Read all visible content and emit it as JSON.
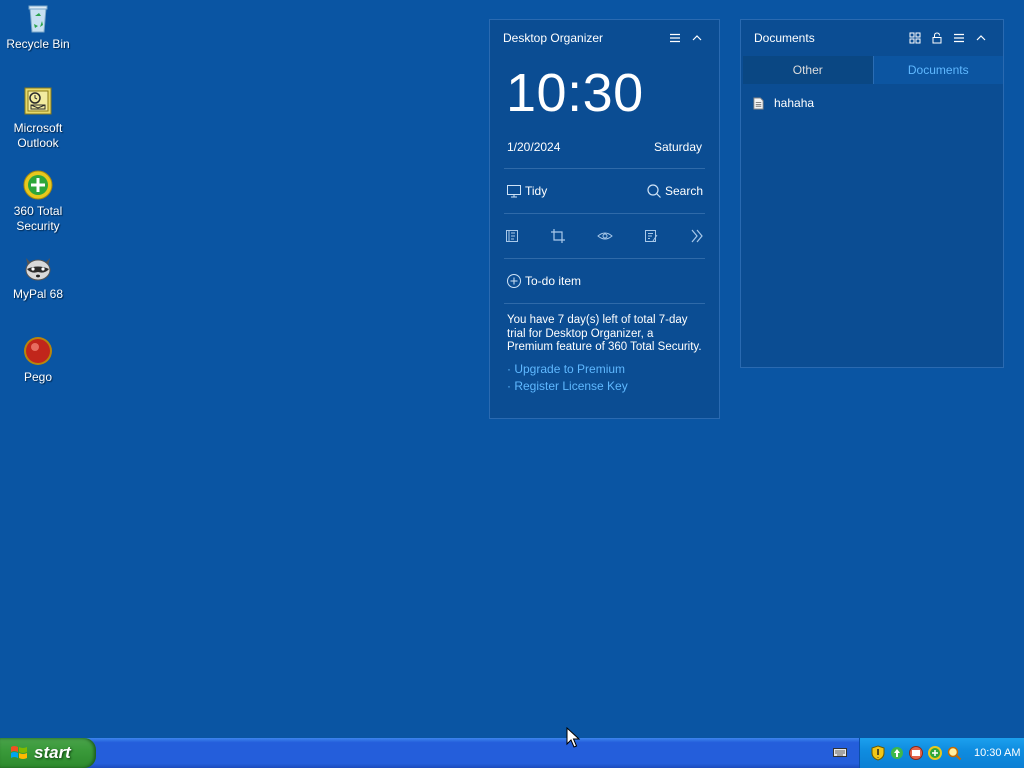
{
  "desktop": {
    "icons": [
      {
        "label": "Recycle Bin"
      },
      {
        "label": "Microsoft Outlook"
      },
      {
        "label": "360 Total Security"
      },
      {
        "label": "MyPal 68"
      },
      {
        "label": "Pego"
      }
    ]
  },
  "organizer": {
    "title": "Desktop Organizer",
    "time": "10:30",
    "date": "1/20/2024",
    "weekday": "Saturday",
    "tidy_label": "Tidy",
    "search_label": "Search",
    "todo_label": "To-do item",
    "trial_text": "You have 7 day(s) left of total 7-day trial for Desktop Organizer, a Premium feature of 360 Total Security.",
    "upgrade_link": "· Upgrade to Premium",
    "register_link": "· Register License Key"
  },
  "documents": {
    "title": "Documents",
    "tabs": [
      {
        "label": "Other",
        "active": true
      },
      {
        "label": "Documents",
        "active": false
      }
    ],
    "files": [
      {
        "name": "hahaha"
      }
    ]
  },
  "taskbar": {
    "start_label": "start",
    "clock": "10:30 AM"
  },
  "colors": {
    "desktop_bg": "#0a55a3",
    "link": "#5fb8ff",
    "taskbar": "#245edb",
    "start": "#3a9a3a"
  }
}
